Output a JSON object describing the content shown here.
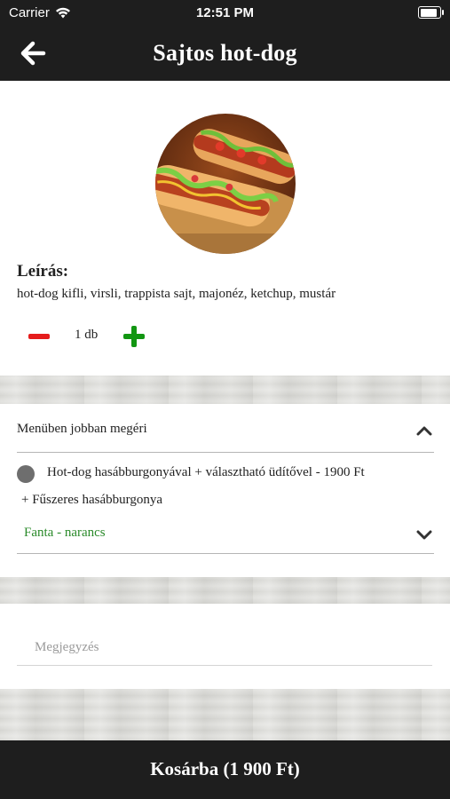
{
  "status_bar": {
    "carrier": "Carrier",
    "time": "12:51 PM",
    "battery_level": 1.0
  },
  "nav": {
    "title": "Sajtos hot-dog",
    "back_icon": "arrow-left-icon"
  },
  "product": {
    "image_icon": "hot-dog-photo",
    "description_heading": "Leírás:",
    "description": "hot-dog kifli, virsli, trappista sajt, majonéz, ketchup, mustár",
    "quantity_label": "1 db",
    "quantity": 1
  },
  "menu": {
    "header": "Menüben jobban megéri",
    "option_title": "Hot-dog hasábburgonyával + választható üdítővel - 1900 Ft",
    "option_subtitle": "+ Fűszeres hasábburgonya",
    "drink_selected": "Fanta - narancs"
  },
  "note": {
    "placeholder": "Megjegyzés",
    "value": ""
  },
  "cart": {
    "label": "Kosárba (1 900 Ft)"
  },
  "colors": {
    "bar_bg": "#1e1e1e",
    "minus": "#e51c1c",
    "plus": "#129612",
    "drink_text": "#2a8a2a"
  }
}
